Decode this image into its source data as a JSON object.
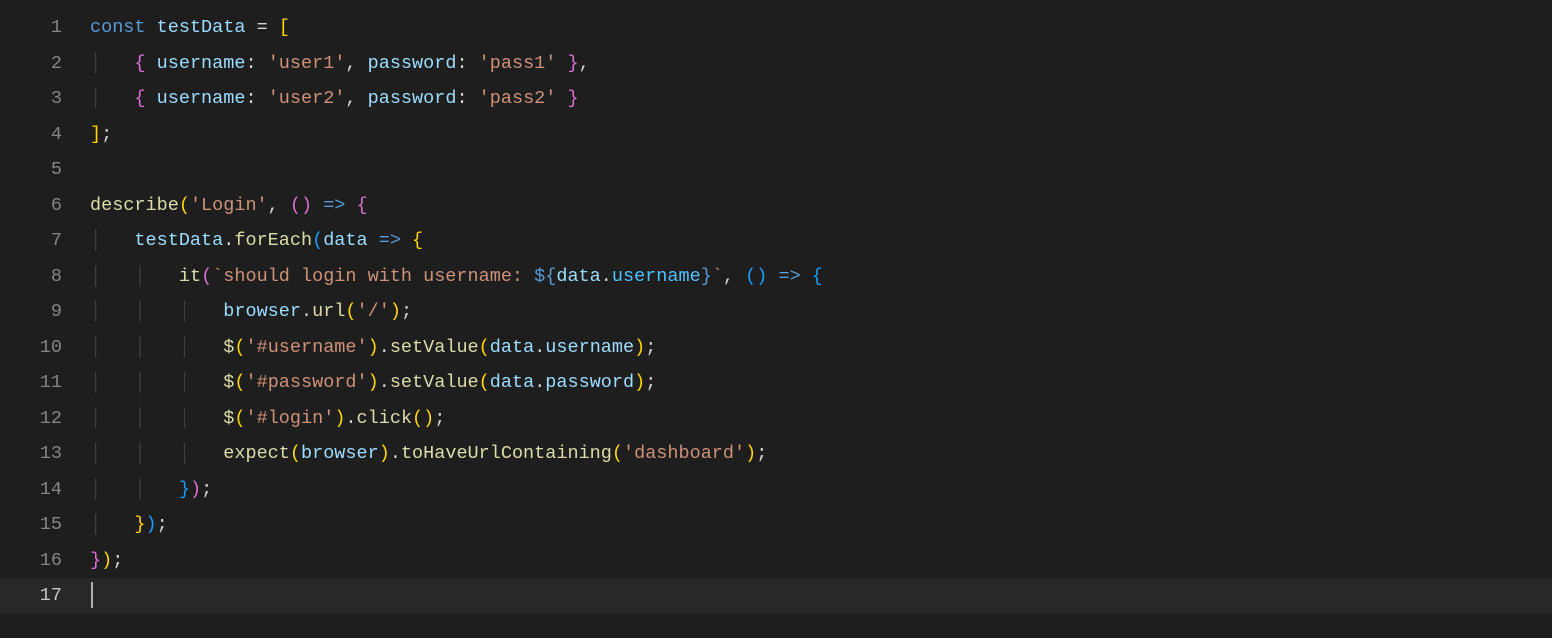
{
  "editor": {
    "theme": "Dark+",
    "line_count": 17,
    "current_line": 17,
    "cursor_col": 1,
    "line_numbers": [
      "1",
      "2",
      "3",
      "4",
      "5",
      "6",
      "7",
      "8",
      "9",
      "10",
      "11",
      "12",
      "13",
      "14",
      "15",
      "16",
      "17"
    ],
    "indent_size": 4,
    "indent_char": "space"
  },
  "source_text_plain": [
    "const testData = [",
    "    { username: 'user1', password: 'pass1' },",
    "    { username: 'user2', password: 'pass2' }",
    "];",
    "",
    "describe('Login', () => {",
    "    testData.forEach(data => {",
    "        it(`should login with username: ${data.username}`, () => {",
    "            browser.url('/');",
    "            $('#username').setValue(data.username);",
    "            $('#password').setValue(data.password);",
    "            $('#login').click();",
    "            expect(browser).toHaveUrlContaining('dashboard');",
    "        });",
    "    });",
    "});",
    ""
  ],
  "tokens": [
    [
      [
        "const ",
        "kw"
      ],
      [
        "testData",
        "id"
      ],
      [
        " ",
        "plain"
      ],
      [
        "=",
        "op"
      ],
      [
        " ",
        "plain"
      ],
      [
        "[",
        "brk1"
      ]
    ],
    [
      [
        "    ",
        "indent"
      ],
      [
        "{",
        "brk2"
      ],
      [
        " ",
        "plain"
      ],
      [
        "username",
        "id"
      ],
      [
        ":",
        "op"
      ],
      [
        " ",
        "plain"
      ],
      [
        "'user1'",
        "str"
      ],
      [
        ", ",
        "plain"
      ],
      [
        "password",
        "id"
      ],
      [
        ":",
        "op"
      ],
      [
        " ",
        "plain"
      ],
      [
        "'pass1'",
        "str"
      ],
      [
        " ",
        "plain"
      ],
      [
        "}",
        "brk2"
      ],
      [
        ",",
        "plain"
      ]
    ],
    [
      [
        "    ",
        "indent"
      ],
      [
        "{",
        "brk2"
      ],
      [
        " ",
        "plain"
      ],
      [
        "username",
        "id"
      ],
      [
        ":",
        "op"
      ],
      [
        " ",
        "plain"
      ],
      [
        "'user2'",
        "str"
      ],
      [
        ", ",
        "plain"
      ],
      [
        "password",
        "id"
      ],
      [
        ":",
        "op"
      ],
      [
        " ",
        "plain"
      ],
      [
        "'pass2'",
        "str"
      ],
      [
        " ",
        "plain"
      ],
      [
        "}",
        "brk2"
      ]
    ],
    [
      [
        "]",
        "brk1"
      ],
      [
        ";",
        "plain"
      ]
    ],
    [],
    [
      [
        "describe",
        "fn"
      ],
      [
        "(",
        "brk1"
      ],
      [
        "'Login'",
        "str"
      ],
      [
        ", ",
        "plain"
      ],
      [
        "(",
        "brk2"
      ],
      [
        ")",
        "brk2"
      ],
      [
        " ",
        "plain"
      ],
      [
        "=>",
        "kw"
      ],
      [
        " ",
        "plain"
      ],
      [
        "{",
        "brk2"
      ]
    ],
    [
      [
        "    ",
        "indent"
      ],
      [
        "testData",
        "id"
      ],
      [
        ".",
        "plain"
      ],
      [
        "forEach",
        "fn"
      ],
      [
        "(",
        "brk3"
      ],
      [
        "data",
        "id"
      ],
      [
        " ",
        "plain"
      ],
      [
        "=>",
        "kw"
      ],
      [
        " ",
        "plain"
      ],
      [
        "{",
        "brk1"
      ]
    ],
    [
      [
        "    ",
        "indent"
      ],
      [
        "    ",
        "indent"
      ],
      [
        "it",
        "fn"
      ],
      [
        "(",
        "brk2"
      ],
      [
        "`should login with username: ",
        "str"
      ],
      [
        "${",
        "kw"
      ],
      [
        "data",
        "id"
      ],
      [
        ".",
        "plain"
      ],
      [
        "username",
        "prop"
      ],
      [
        "}",
        "kw"
      ],
      [
        "`",
        "str"
      ],
      [
        ", ",
        "plain"
      ],
      [
        "(",
        "brk3"
      ],
      [
        ")",
        "brk3"
      ],
      [
        " ",
        "plain"
      ],
      [
        "=>",
        "kw"
      ],
      [
        " ",
        "plain"
      ],
      [
        "{",
        "brk3"
      ]
    ],
    [
      [
        "    ",
        "indent"
      ],
      [
        "    ",
        "indent"
      ],
      [
        "    ",
        "indent"
      ],
      [
        "browser",
        "id"
      ],
      [
        ".",
        "plain"
      ],
      [
        "url",
        "fn"
      ],
      [
        "(",
        "brk1"
      ],
      [
        "'/'",
        "str"
      ],
      [
        ")",
        "brk1"
      ],
      [
        ";",
        "plain"
      ]
    ],
    [
      [
        "    ",
        "indent"
      ],
      [
        "    ",
        "indent"
      ],
      [
        "    ",
        "indent"
      ],
      [
        "$",
        "fn"
      ],
      [
        "(",
        "brk1"
      ],
      [
        "'#username'",
        "str"
      ],
      [
        ")",
        "brk1"
      ],
      [
        ".",
        "plain"
      ],
      [
        "setValue",
        "fn"
      ],
      [
        "(",
        "brk1"
      ],
      [
        "data",
        "id"
      ],
      [
        ".",
        "plain"
      ],
      [
        "username",
        "id"
      ],
      [
        ")",
        "brk1"
      ],
      [
        ";",
        "plain"
      ]
    ],
    [
      [
        "    ",
        "indent"
      ],
      [
        "    ",
        "indent"
      ],
      [
        "    ",
        "indent"
      ],
      [
        "$",
        "fn"
      ],
      [
        "(",
        "brk1"
      ],
      [
        "'#password'",
        "str"
      ],
      [
        ")",
        "brk1"
      ],
      [
        ".",
        "plain"
      ],
      [
        "setValue",
        "fn"
      ],
      [
        "(",
        "brk1"
      ],
      [
        "data",
        "id"
      ],
      [
        ".",
        "plain"
      ],
      [
        "password",
        "id"
      ],
      [
        ")",
        "brk1"
      ],
      [
        ";",
        "plain"
      ]
    ],
    [
      [
        "    ",
        "indent"
      ],
      [
        "    ",
        "indent"
      ],
      [
        "    ",
        "indent"
      ],
      [
        "$",
        "fn"
      ],
      [
        "(",
        "brk1"
      ],
      [
        "'#login'",
        "str"
      ],
      [
        ")",
        "brk1"
      ],
      [
        ".",
        "plain"
      ],
      [
        "click",
        "fn"
      ],
      [
        "(",
        "brk1"
      ],
      [
        ")",
        "brk1"
      ],
      [
        ";",
        "plain"
      ]
    ],
    [
      [
        "    ",
        "indent"
      ],
      [
        "    ",
        "indent"
      ],
      [
        "    ",
        "indent"
      ],
      [
        "expect",
        "fn"
      ],
      [
        "(",
        "brk1"
      ],
      [
        "browser",
        "id"
      ],
      [
        ")",
        "brk1"
      ],
      [
        ".",
        "plain"
      ],
      [
        "toHaveUrlContaining",
        "fn"
      ],
      [
        "(",
        "brk1"
      ],
      [
        "'dashboard'",
        "str"
      ],
      [
        ")",
        "brk1"
      ],
      [
        ";",
        "plain"
      ]
    ],
    [
      [
        "    ",
        "indent"
      ],
      [
        "    ",
        "indent"
      ],
      [
        "}",
        "brk3"
      ],
      [
        ")",
        "brk2"
      ],
      [
        ";",
        "plain"
      ]
    ],
    [
      [
        "    ",
        "indent"
      ],
      [
        "}",
        "brk1"
      ],
      [
        ")",
        "brk3"
      ],
      [
        ";",
        "plain"
      ]
    ],
    [
      [
        "}",
        "brk2"
      ],
      [
        ")",
        "brk1"
      ],
      [
        ";",
        "plain"
      ]
    ],
    []
  ],
  "colors": {
    "background": "#1e1e1e",
    "foreground": "#d4d4d4",
    "gutter": "#858585",
    "gutter_active": "#c6c6c6",
    "keyword": "#569cd6",
    "identifier": "#9cdcfe",
    "function": "#dcdcaa",
    "property_special": "#4fc1ff",
    "string": "#ce9178",
    "bracket1": "#ffd700",
    "bracket2": "#da70d6",
    "bracket3": "#179fff",
    "indent_guide": "#404040",
    "cursor": "#aeafad"
  }
}
